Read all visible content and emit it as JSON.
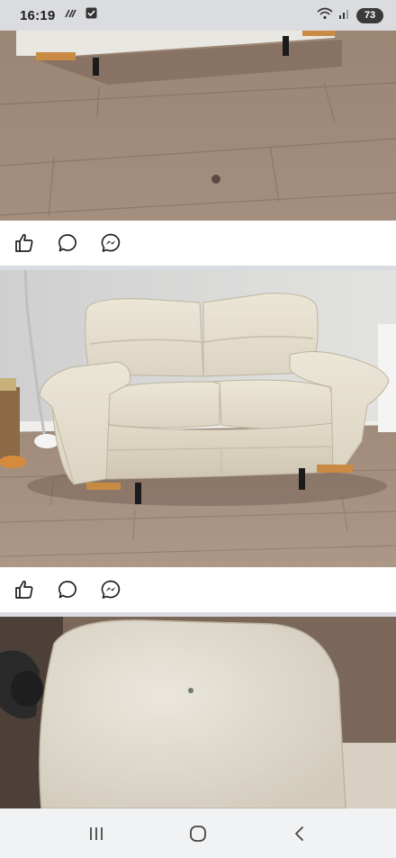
{
  "status_bar": {
    "time": "16:19",
    "battery_level": "73",
    "icons": [
      "hashtag-notification-icon",
      "checkbox-notification-icon",
      "wifi-icon",
      "signal-icon"
    ]
  },
  "feed": {
    "posts": [
      {
        "image": "sofa-photo-bottom-floor",
        "actions": [
          "like-icon",
          "comment-icon",
          "messenger-icon"
        ]
      },
      {
        "image": "cream-leather-two-seater-sofa",
        "actions": [
          "like-icon",
          "comment-icon",
          "messenger-icon"
        ]
      },
      {
        "image": "sofa-armrest-closeup"
      }
    ]
  },
  "nav_bar": {
    "buttons": [
      "recents-icon",
      "home-icon",
      "back-icon"
    ]
  },
  "colors": {
    "status_bar_bg": "#dadcdf",
    "divider": "#d9dce0",
    "nav_bar_bg": "#f1f2f4",
    "icon": "#1c1e21"
  }
}
